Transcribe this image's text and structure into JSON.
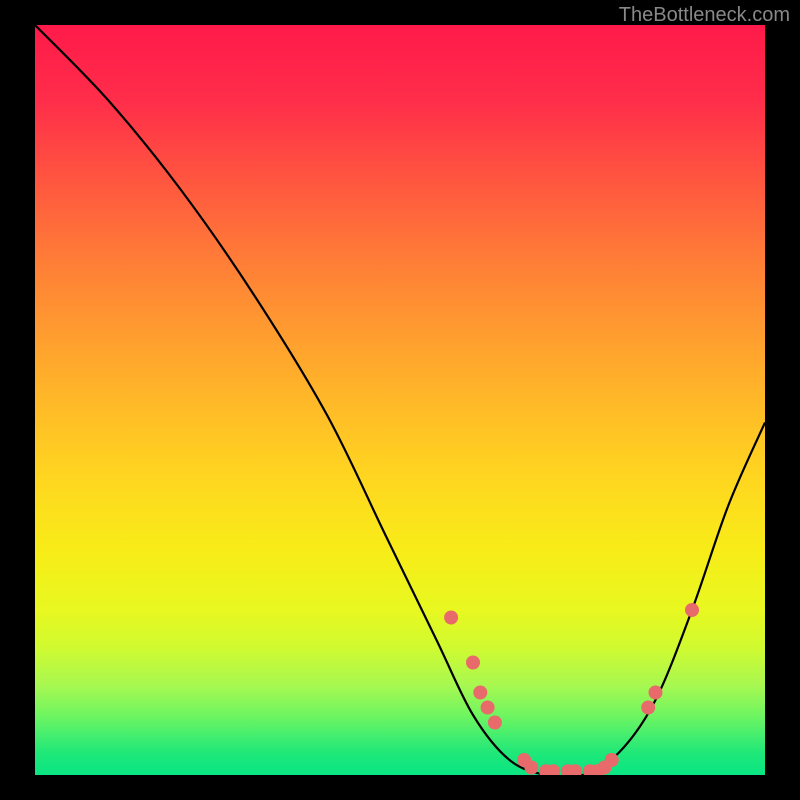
{
  "watermark": "TheBottleneck.com",
  "chart_data": {
    "type": "line",
    "title": "",
    "xlabel": "",
    "ylabel": "",
    "xlim": [
      0,
      100
    ],
    "ylim": [
      0,
      100
    ],
    "curve": {
      "points": [
        {
          "x": 0,
          "y": 100
        },
        {
          "x": 10,
          "y": 90
        },
        {
          "x": 20,
          "y": 78
        },
        {
          "x": 30,
          "y": 64
        },
        {
          "x": 40,
          "y": 48
        },
        {
          "x": 48,
          "y": 32
        },
        {
          "x": 55,
          "y": 18
        },
        {
          "x": 60,
          "y": 8
        },
        {
          "x": 65,
          "y": 2
        },
        {
          "x": 70,
          "y": 0
        },
        {
          "x": 75,
          "y": 0
        },
        {
          "x": 80,
          "y": 3
        },
        {
          "x": 85,
          "y": 10
        },
        {
          "x": 90,
          "y": 22
        },
        {
          "x": 95,
          "y": 36
        },
        {
          "x": 100,
          "y": 47
        }
      ]
    },
    "scatter_points": [
      {
        "x": 57,
        "y": 21
      },
      {
        "x": 60,
        "y": 15
      },
      {
        "x": 61,
        "y": 11
      },
      {
        "x": 62,
        "y": 9
      },
      {
        "x": 63,
        "y": 7
      },
      {
        "x": 67,
        "y": 2
      },
      {
        "x": 68,
        "y": 1
      },
      {
        "x": 70,
        "y": 0.5
      },
      {
        "x": 71,
        "y": 0.5
      },
      {
        "x": 73,
        "y": 0.5
      },
      {
        "x": 74,
        "y": 0.5
      },
      {
        "x": 76,
        "y": 0.5
      },
      {
        "x": 77,
        "y": 0.5
      },
      {
        "x": 78,
        "y": 1
      },
      {
        "x": 79,
        "y": 2
      },
      {
        "x": 84,
        "y": 9
      },
      {
        "x": 85,
        "y": 11
      },
      {
        "x": 90,
        "y": 22
      }
    ],
    "gradient_stops": [
      {
        "offset": 0,
        "color": "#ff1a4a"
      },
      {
        "offset": 50,
        "color": "#ffd520"
      },
      {
        "offset": 100,
        "color": "#0ae583"
      }
    ],
    "scatter_color": "#e86a6a",
    "curve_color": "#000000"
  }
}
